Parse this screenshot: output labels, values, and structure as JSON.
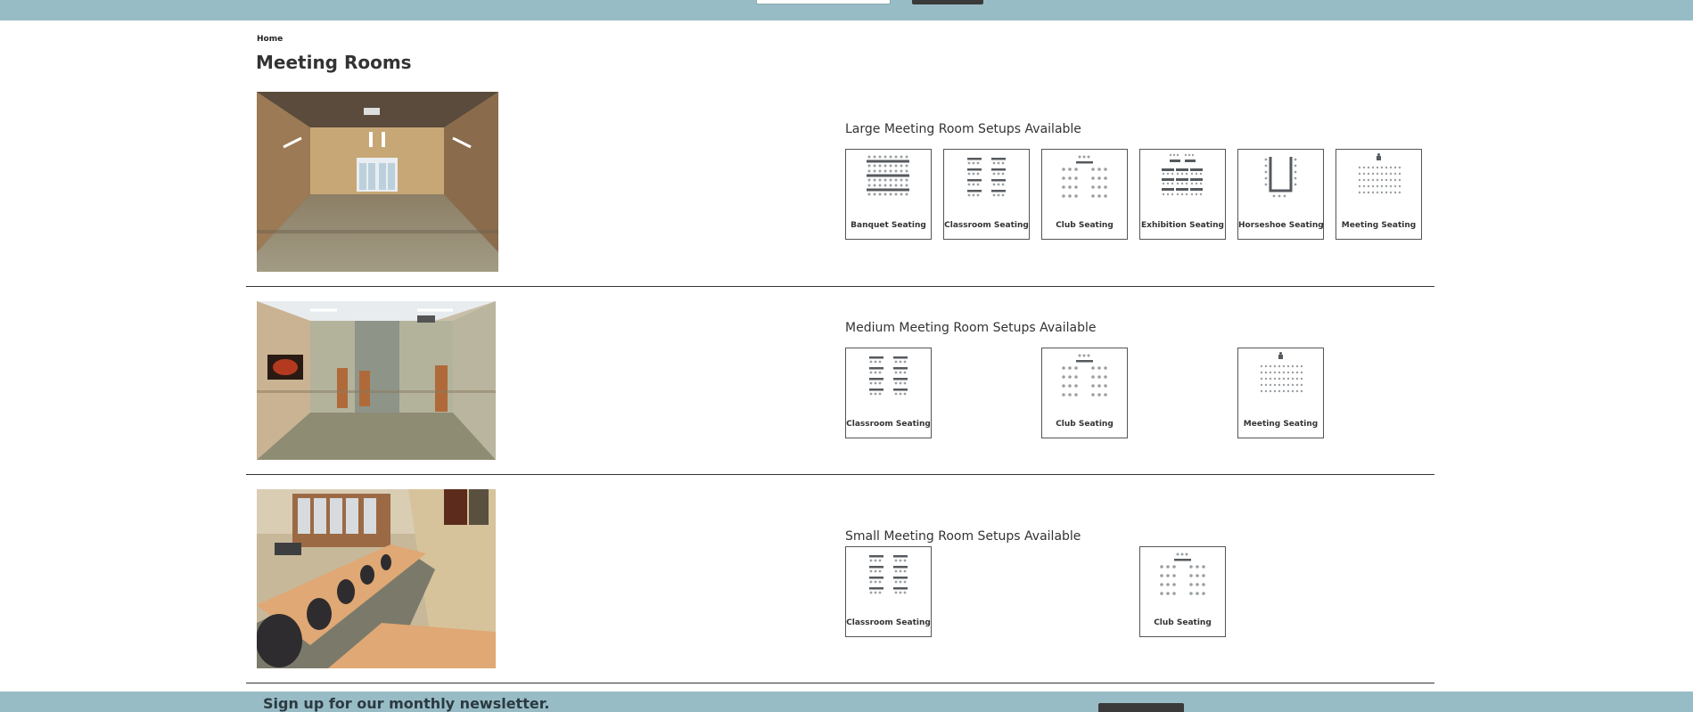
{
  "breadcrumb": {
    "home": "Home"
  },
  "page": {
    "title": "Meeting Rooms"
  },
  "rooms": [
    {
      "setups_title": "Large Meeting Room Setups Available",
      "photo": "large-meeting-room-photo",
      "setups": [
        {
          "label": "Banquet Seating",
          "icon": "banquet-seating-icon"
        },
        {
          "label": "Classroom Seating",
          "icon": "classroom-seating-icon"
        },
        {
          "label": "Club Seating",
          "icon": "club-seating-icon"
        },
        {
          "label": "Exhibition Seating",
          "icon": "exhibition-seating-icon"
        },
        {
          "label": "Horseshoe Seating",
          "icon": "horseshoe-seating-icon"
        },
        {
          "label": "Meeting Seating",
          "icon": "meeting-seating-icon"
        }
      ]
    },
    {
      "setups_title": "Medium Meeting Room Setups Available",
      "photo": "medium-meeting-room-photo",
      "setups": [
        {
          "label": "Classroom Seating",
          "icon": "classroom-seating-icon"
        },
        {
          "label": "Club Seating",
          "icon": "club-seating-icon"
        },
        {
          "label": "Meeting Seating",
          "icon": "meeting-seating-icon"
        }
      ]
    },
    {
      "setups_title": "Small Meeting Room Setups Available",
      "photo": "small-meeting-room-photo",
      "setups": [
        {
          "label": "Classroom Seating",
          "icon": "classroom-seating-icon"
        },
        {
          "label": "Club Seating",
          "icon": "club-seating-icon"
        }
      ]
    }
  ],
  "footer": {
    "newsletter": "Sign up for our monthly newsletter."
  },
  "colors": {
    "bar": "#98bcc6",
    "dark": "#3a3a3a",
    "icon": "#555a5e"
  }
}
